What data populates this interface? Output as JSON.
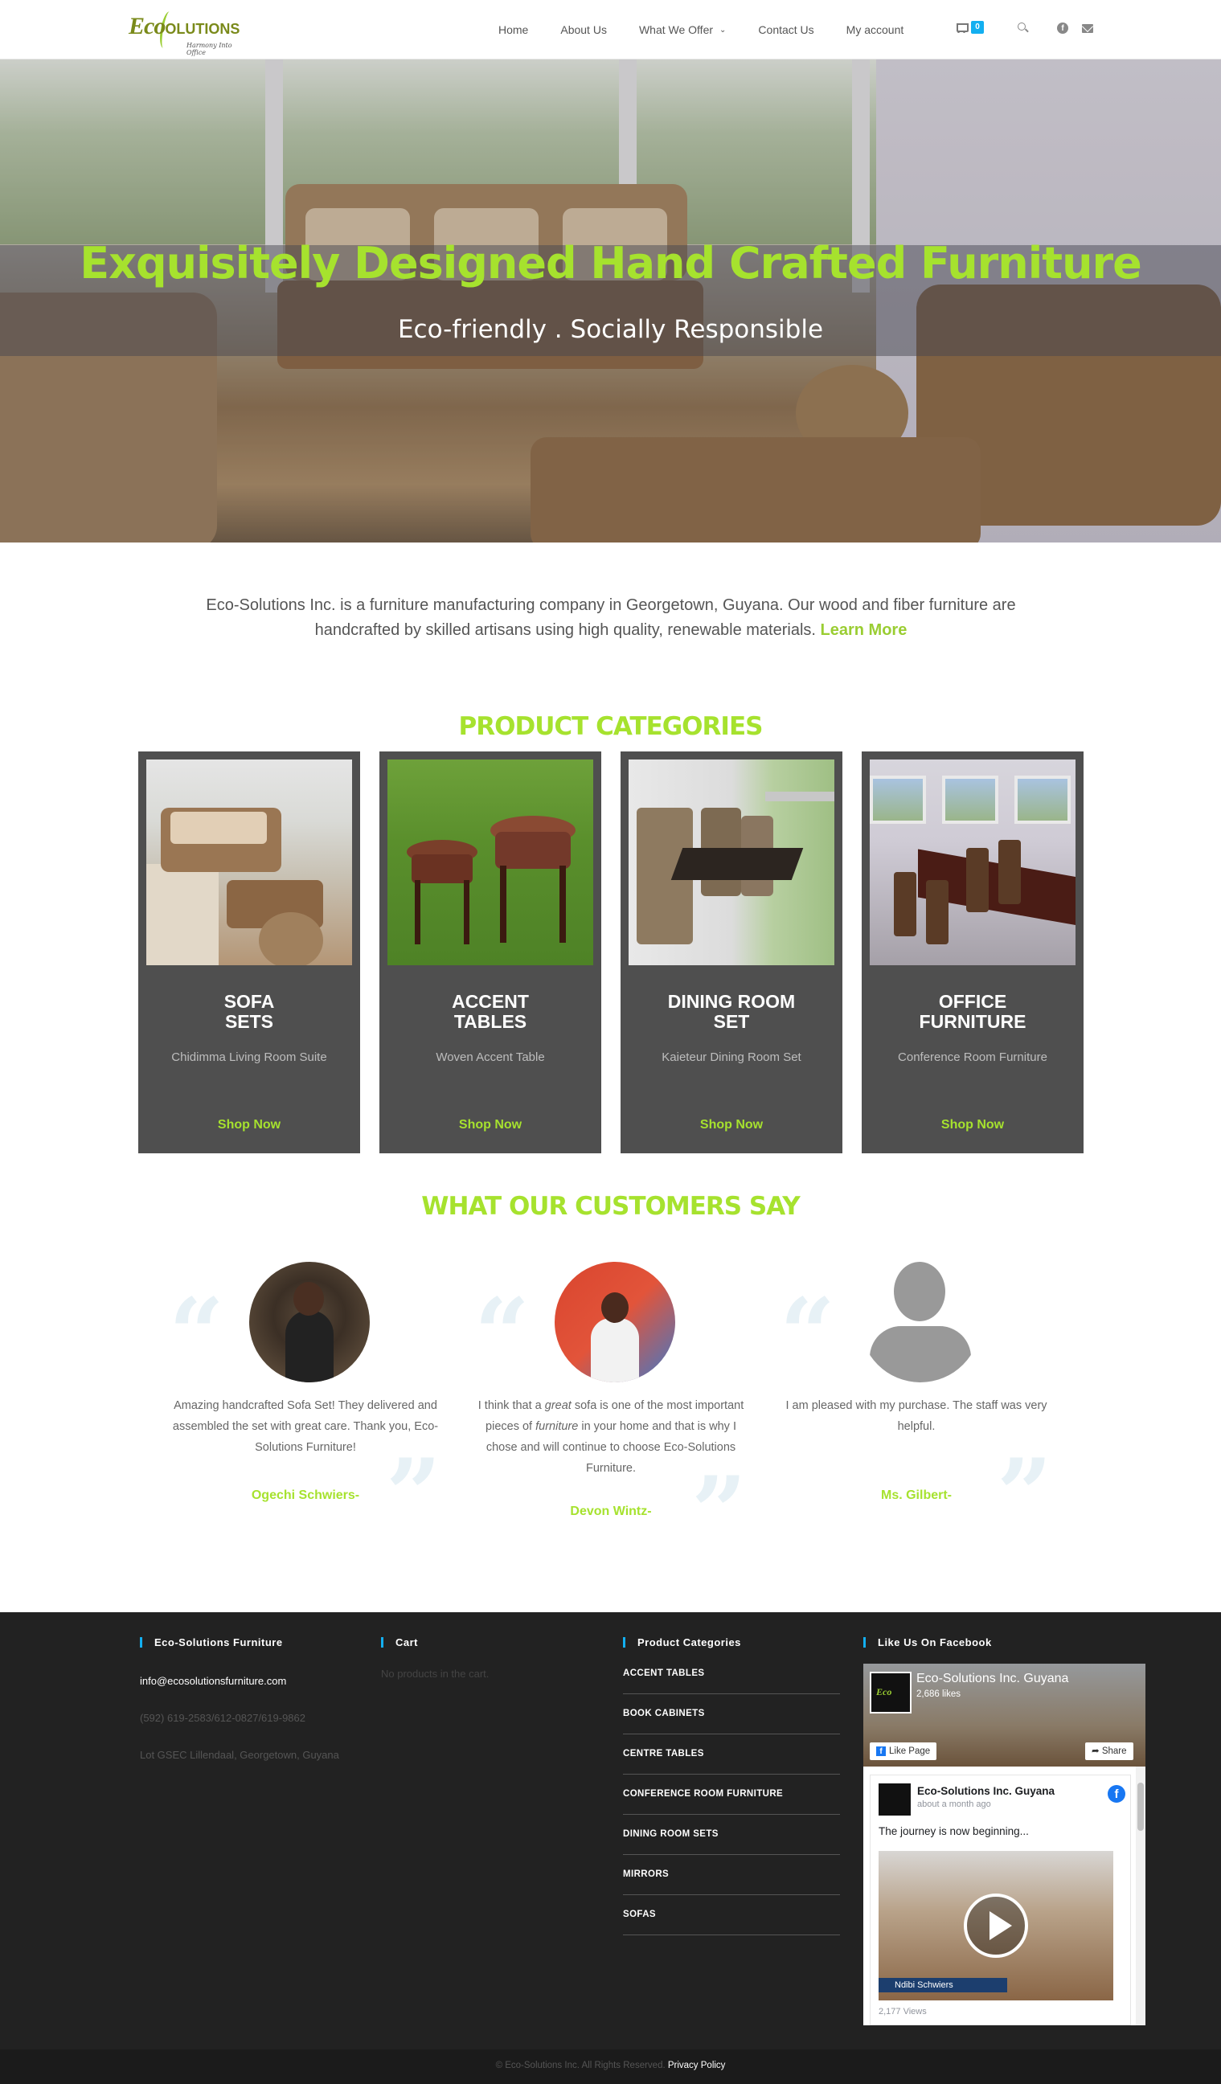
{
  "header": {
    "logo_text_1": "Eco",
    "logo_text_2": "OLUTIONS",
    "logo_tagline": "Harmony Into Office",
    "nav": [
      "Home",
      "About Us",
      "What We Offer",
      "Contact Us",
      "My account"
    ],
    "cart_count": "0"
  },
  "hero": {
    "title": "Exquisitely Designed Hand Crafted Furniture",
    "subtitle": "Eco-friendly . Socially Responsible"
  },
  "intro": {
    "text": "Eco-Solutions Inc. is a furniture manufacturing company in Georgetown, Guyana. Our wood and fiber furniture are handcrafted by skilled artisans using high quality, renewable materials.",
    "link": "Learn More"
  },
  "categories": {
    "heading": "PRODUCT CATEGORIES",
    "items": [
      {
        "title_1": "SOFA",
        "title_2": "SETS",
        "subtitle": "Chidimma Living Room Suite",
        "cta": "Shop Now"
      },
      {
        "title_1": "ACCENT",
        "title_2": "TABLES",
        "subtitle": "Woven Accent Table",
        "cta": "Shop Now"
      },
      {
        "title_1": "DINING ROOM",
        "title_2": "SET",
        "subtitle": "Kaieteur Dining Room Set",
        "cta": "Shop Now"
      },
      {
        "title_1": "OFFICE",
        "title_2": "FURNITURE",
        "subtitle": "Conference Room Furniture",
        "cta": "Shop Now"
      }
    ]
  },
  "testimonials": {
    "heading": "WHAT OUR CUSTOMERS SAY",
    "items": [
      {
        "text": "Amazing handcrafted Sofa Set! They delivered and assembled the set with great care. Thank you, Eco-Solutions Furniture!",
        "name": "Ogechi Schwiers-"
      },
      {
        "text_a": "I think that a ",
        "text_em1": "great",
        "text_b": " sofa is one of the most important pieces of ",
        "text_em2": "furniture",
        "text_c": " in your home and that is why I chose and will continue to choose Eco-Solutions Furniture.",
        "name": "Devon Wintz-"
      },
      {
        "text": "I am pleased with my purchase. The staff was very helpful.",
        "name": "Ms. Gilbert-"
      }
    ]
  },
  "footer": {
    "col1": {
      "title": "Eco-Solutions Furniture",
      "email": "info@ecosolutionsfurniture.com",
      "phone": "(592) 619-2583/612-0827/619-9862",
      "address": "Lot GSEC Lillendaal, Georgetown, Guyana"
    },
    "col2": {
      "title": "Cart",
      "empty": "No products in the cart."
    },
    "col3": {
      "title": "Product Categories",
      "links": [
        "ACCENT TABLES",
        "BOOK CABINETS",
        "CENTRE TABLES",
        "CONFERENCE ROOM FURNITURE",
        "DINING ROOM SETS",
        "MIRRORS",
        "SOFAS"
      ]
    },
    "col4": {
      "title": "Like Us On Facebook",
      "page_name": "Eco-Solutions Inc. Guyana",
      "likes": "2,686 likes",
      "like_button": "Like Page",
      "share_button": "Share",
      "post_name": "Eco-Solutions Inc. Guyana",
      "post_time": "about a month ago",
      "post_text": "The journey is now beginning...",
      "video_caption": "Ndibi Schwiers",
      "views": "2,177 Views"
    }
  },
  "bottom": {
    "copyright": "© Eco-Solutions Inc. All Rights Reserved.",
    "privacy": "Privacy Policy"
  }
}
